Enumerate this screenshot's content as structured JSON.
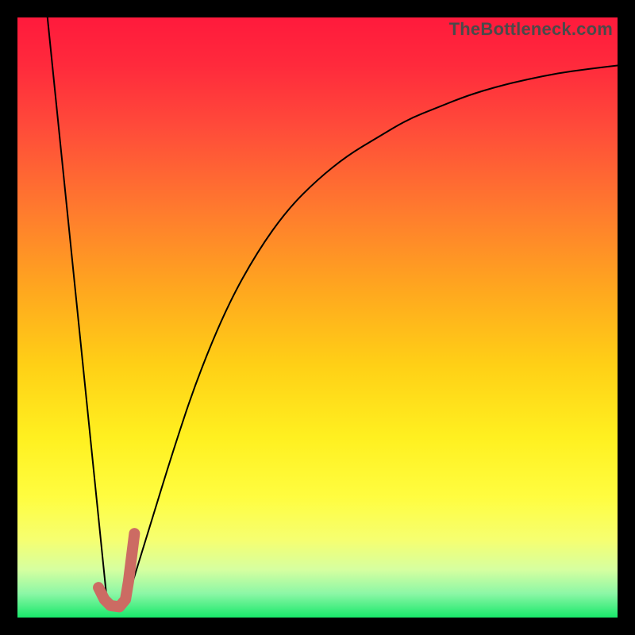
{
  "watermark": {
    "text": "TheBottleneck.com"
  },
  "colors": {
    "black_frame": "#000000",
    "curve_thin": "#000000",
    "marker_thick": "#cc6b63",
    "gradient_top": "#ff1a3c",
    "gradient_bottom": "#18e86a"
  },
  "chart_data": {
    "type": "line",
    "title": "",
    "xlabel": "",
    "ylabel": "",
    "xlim": [
      0,
      100
    ],
    "ylim": [
      0,
      100
    ],
    "grid": false,
    "legend": false,
    "series": [
      {
        "name": "left-descending-line",
        "x": [
          5,
          15
        ],
        "values": [
          100,
          2
        ],
        "stroke": "#000000",
        "width": 2
      },
      {
        "name": "right-rising-curve",
        "x": [
          18,
          22,
          26,
          30,
          35,
          40,
          45,
          50,
          55,
          60,
          65,
          70,
          75,
          80,
          85,
          90,
          95,
          100
        ],
        "values": [
          2,
          15,
          28,
          40,
          52,
          61,
          68,
          73,
          77,
          80,
          83,
          85,
          87,
          88.5,
          89.7,
          90.7,
          91.4,
          92
        ],
        "stroke": "#000000",
        "width": 2
      },
      {
        "name": "bottom-hook-marker",
        "x": [
          13.5,
          14.5,
          15.5,
          17,
          18,
          18.5,
          19,
          19.5
        ],
        "values": [
          5,
          3,
          2,
          1.8,
          3,
          6,
          10,
          14
        ],
        "stroke": "#cc6b63",
        "width": 14
      }
    ]
  }
}
